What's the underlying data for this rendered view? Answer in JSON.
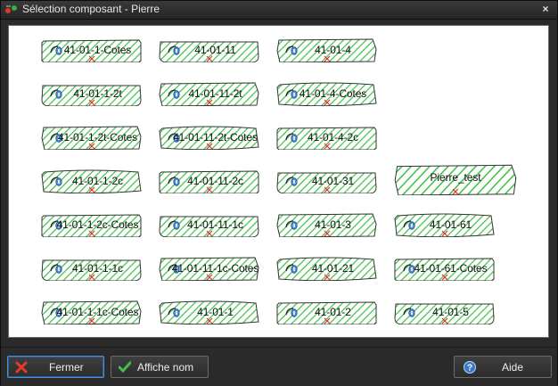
{
  "window": {
    "title": "Sélection composant - Pierre",
    "close_glyph": "×"
  },
  "components": {
    "row1": [
      "41-01-1-Cotes",
      "41-01-11",
      "41-01-4"
    ],
    "row2": [
      "41-01-1-2t",
      "41-01-11-2t",
      "41-01-4-Cotes"
    ],
    "row3": [
      "41-01-1-2t-Cotes",
      "41-01-11-2t-Cotes",
      "41-01-4-2c"
    ],
    "row4": [
      "41-01-1-2c",
      "41-01-11-2c",
      "41-01-31",
      "Pierre_test"
    ],
    "row5": [
      "41-01-1-2c-Cotes",
      "41-01-11-1c",
      "41-01-3",
      "41-01-61"
    ],
    "row6": [
      "41-01-1-1c",
      "41-01-11-1c-Cotes",
      "41-01-21",
      "41-01-61-Cotes"
    ],
    "row7": [
      "41-01-1-1c-Cotes",
      "41-01-1",
      "41-01-2",
      "41-01-5"
    ]
  },
  "buttons": {
    "close_label": "Fermer",
    "show_name_label": "Affiche nom",
    "help_label": "Aide"
  },
  "colors": {
    "hatch": "#33c43a",
    "mark": "#e0302a",
    "accent_focus": "#4c8fd6"
  },
  "icons": {
    "title": "app-icon",
    "close": "close-icon",
    "fermer": "red-x-icon",
    "affiche": "green-check-icon",
    "aide": "help-icon"
  }
}
